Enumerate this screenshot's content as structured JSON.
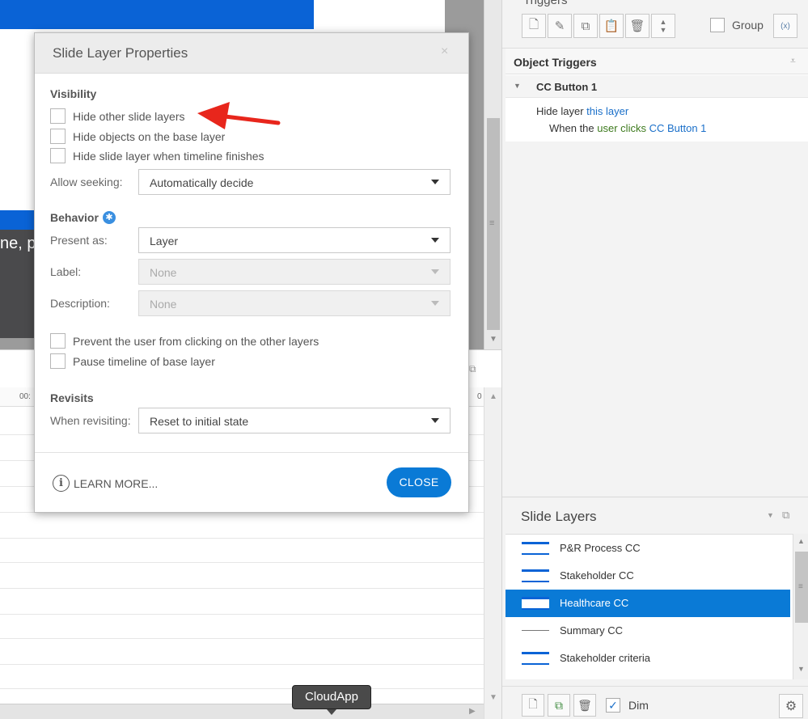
{
  "triggers_panel": {
    "header_partial": "Triggers",
    "group_label": "Group",
    "object_triggers_title": "Object Triggers",
    "trigger_object": "CC Button 1",
    "action_prefix": "Hide layer",
    "action_target": "this layer",
    "condition_prefix": "When the",
    "condition_event": "user clicks",
    "condition_object": "CC Button 1"
  },
  "slide_layers": {
    "title": "Slide Layers",
    "items": [
      {
        "label": "P&R Process CC"
      },
      {
        "label": "Stakeholder CC"
      },
      {
        "label": "Healthcare CC"
      },
      {
        "label": "Summary CC"
      },
      {
        "label": "Stakeholder criteria"
      }
    ],
    "selected_index": 2,
    "dim_label": "Dim",
    "dim_checked": true
  },
  "slide": {
    "partial_text": "ne, p"
  },
  "timeline": {
    "tick_label": "00:",
    "tick_label_right": "0"
  },
  "dialog": {
    "title": "Slide Layer Properties",
    "close_x": "×",
    "visibility": {
      "title": "Visibility",
      "hide_other_layers": "Hide other slide layers",
      "hide_base_objects": "Hide objects on the base layer",
      "hide_when_finished": "Hide slide layer when timeline finishes",
      "allow_seeking_label": "Allow seeking:",
      "allow_seeking_value": "Automatically decide"
    },
    "behavior": {
      "title": "Behavior",
      "present_as_label": "Present as:",
      "present_as_value": "Layer",
      "label_label": "Label:",
      "label_value": "None",
      "description_label": "Description:",
      "description_value": "None",
      "prevent_click": "Prevent the user from clicking on the other layers",
      "pause_timeline": "Pause timeline of base layer"
    },
    "revisits": {
      "title": "Revisits",
      "when_revisiting_label": "When revisiting:",
      "when_revisiting_value": "Reset to initial state"
    },
    "learn_more": "LEARN MORE...",
    "close_button": "CLOSE"
  },
  "tooltip": {
    "text": "CloudApp"
  },
  "colors": {
    "accent": "#0a7ad6",
    "slide_blue": "#0a63d6",
    "annotation_arrow": "#e8261c"
  }
}
